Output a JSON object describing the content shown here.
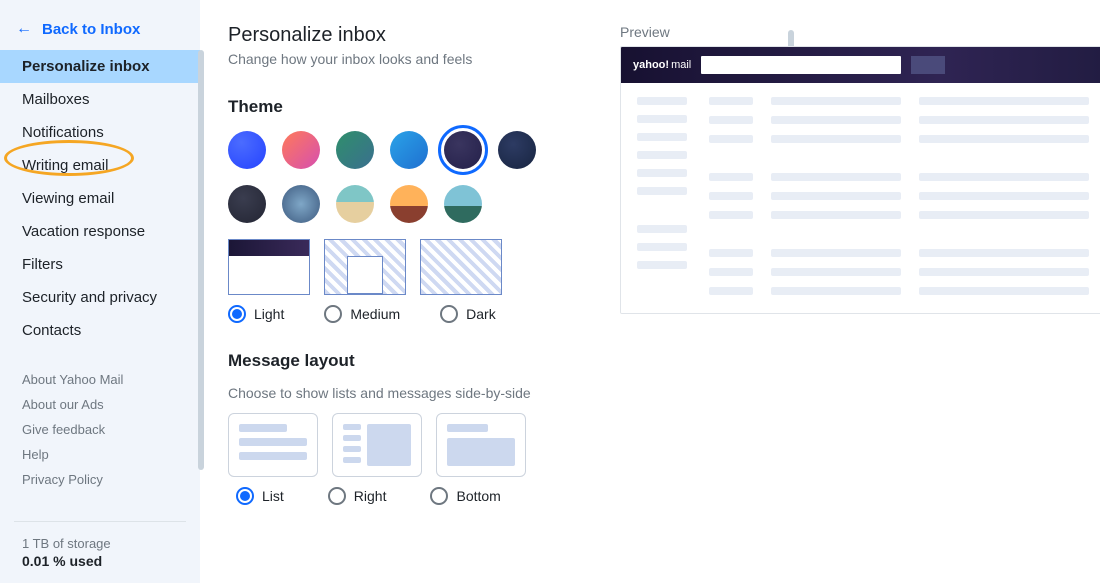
{
  "back_link": "Back to Inbox",
  "sidebar": {
    "items": [
      "Personalize inbox",
      "Mailboxes",
      "Notifications",
      "Writing email",
      "Viewing email",
      "Vacation response",
      "Filters",
      "Security and privacy",
      "Contacts"
    ],
    "active_index": 0,
    "highlighted_index": 3
  },
  "footer_links": [
    "About Yahoo Mail",
    "About our Ads",
    "Give feedback",
    "Help",
    "Privacy Policy"
  ],
  "storage": {
    "cap": "1 TB of storage",
    "used": "0.01 % used"
  },
  "page": {
    "title": "Personalize inbox",
    "subtitle": "Change how your inbox looks and feels"
  },
  "theme": {
    "title": "Theme",
    "swatches": [
      {
        "name": "blue",
        "css": "radial-gradient(circle at 35% 30%, #4b6cff, #2543ff)"
      },
      {
        "name": "sunset",
        "css": "linear-gradient(135deg,#ff7a59,#d64fb0)"
      },
      {
        "name": "forest",
        "css": "linear-gradient(135deg,#2f8f6b,#3a6f8f)"
      },
      {
        "name": "sky",
        "css": "linear-gradient(135deg,#2aa3e8,#1f6fd0)"
      },
      {
        "name": "midnight",
        "css": "radial-gradient(circle at 40% 35%, #3a355f, #24204a)"
      },
      {
        "name": "navy",
        "css": "radial-gradient(circle at 40% 35%, #2d3b63, #172440)"
      },
      {
        "name": "graphite",
        "css": "radial-gradient(circle at 40% 35%, #3a3d4f, #232533)"
      },
      {
        "name": "mountains",
        "css": "radial-gradient(circle,#7fa7c7,#3d5a7f)"
      },
      {
        "name": "beach",
        "css": "linear-gradient(180deg,#7fc6c6 45%,#e6cf9f 45%)"
      },
      {
        "name": "dusk",
        "css": "linear-gradient(180deg,#ffb25a 55%,#8a3f2f 55%)"
      },
      {
        "name": "lake",
        "css": "linear-gradient(180deg,#7fc3d6 55%,#2f6b5f 55%)"
      }
    ],
    "selected_swatch_index": 4,
    "modes": [
      "Light",
      "Medium",
      "Dark"
    ],
    "selected_mode_index": 0
  },
  "layout": {
    "title": "Message layout",
    "subtitle": "Choose to show lists and messages side-by-side",
    "options": [
      "List",
      "Right",
      "Bottom"
    ],
    "selected_index": 0
  },
  "preview": {
    "label": "Preview",
    "logo_brand": "yahoo!",
    "logo_product": "mail"
  }
}
